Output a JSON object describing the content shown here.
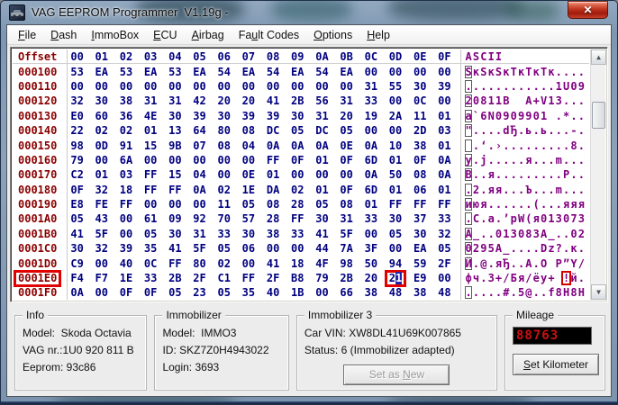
{
  "window": {
    "title": "VAG EEPROM Programmer  V1.19g -",
    "close_glyph": "✕"
  },
  "menu": {
    "items": [
      {
        "label": "File",
        "u": 0
      },
      {
        "label": "Dash",
        "u": 0
      },
      {
        "label": "ImmoBox",
        "u": 0
      },
      {
        "label": "ECU",
        "u": 0
      },
      {
        "label": "Airbag",
        "u": 0
      },
      {
        "label": "Fault Codes",
        "u": 2
      },
      {
        "label": "Options",
        "u": 0
      },
      {
        "label": "Help",
        "u": 0
      }
    ]
  },
  "hex_view": {
    "offset_label": "Offset",
    "columns": [
      "00",
      "01",
      "02",
      "03",
      "04",
      "05",
      "06",
      "07",
      "08",
      "09",
      "0A",
      "0B",
      "0C",
      "0D",
      "0E",
      "0F"
    ],
    "ascii_label": "ASCII",
    "rows": [
      {
        "offset": "000100",
        "bytes": [
          "53",
          "EA",
          "53",
          "EA",
          "53",
          "EA",
          "54",
          "EA",
          "54",
          "EA",
          "54",
          "EA",
          "00",
          "00",
          "00",
          "00"
        ],
        "ascii": "SкSкSкTкTкTк...."
      },
      {
        "offset": "000110",
        "bytes": [
          "00",
          "00",
          "00",
          "00",
          "00",
          "00",
          "00",
          "00",
          "00",
          "00",
          "00",
          "00",
          "31",
          "55",
          "30",
          "39"
        ],
        "ascii": "............1U09"
      },
      {
        "offset": "000120",
        "bytes": [
          "32",
          "30",
          "38",
          "31",
          "31",
          "42",
          "20",
          "20",
          "41",
          "2B",
          "56",
          "31",
          "33",
          "00",
          "0C",
          "00"
        ],
        "ascii": "20811B  A+V13..."
      },
      {
        "offset": "000130",
        "bytes": [
          "E0",
          "60",
          "36",
          "4E",
          "30",
          "39",
          "30",
          "39",
          "39",
          "30",
          "31",
          "20",
          "19",
          "2A",
          "11",
          "01"
        ],
        "ascii": "а`6N0909901 .*.."
      },
      {
        "offset": "000140",
        "bytes": [
          "22",
          "02",
          "02",
          "01",
          "13",
          "64",
          "80",
          "08",
          "DC",
          "05",
          "DC",
          "05",
          "00",
          "00",
          "2D",
          "03"
        ],
        "ascii": "\"....dЂ.ь.ь...-."
      },
      {
        "offset": "000150",
        "bytes": [
          "98",
          "0D",
          "91",
          "15",
          "9B",
          "07",
          "08",
          "04",
          "0A",
          "0A",
          "0A",
          "0E",
          "0A",
          "10",
          "38",
          "01"
        ],
        "ascii": " .‘.›.........8."
      },
      {
        "offset": "000160",
        "bytes": [
          "79",
          "00",
          "6A",
          "00",
          "00",
          "00",
          "00",
          "00",
          "FF",
          "0F",
          "01",
          "0F",
          "6D",
          "01",
          "0F",
          "0A"
        ],
        "ascii": "y.j.....я...m..."
      },
      {
        "offset": "000170",
        "bytes": [
          "C2",
          "01",
          "03",
          "FF",
          "15",
          "04",
          "00",
          "0E",
          "01",
          "00",
          "00",
          "00",
          "0A",
          "50",
          "08",
          "0A"
        ],
        "ascii": "В..я.........P.."
      },
      {
        "offset": "000180",
        "bytes": [
          "0F",
          "32",
          "18",
          "FF",
          "FF",
          "0A",
          "02",
          "1E",
          "DA",
          "02",
          "01",
          "0F",
          "6D",
          "01",
          "06",
          "01"
        ],
        "ascii": ".2.яя...Ъ...m..."
      },
      {
        "offset": "000190",
        "bytes": [
          "E8",
          "FE",
          "FF",
          "00",
          "00",
          "00",
          "11",
          "05",
          "08",
          "28",
          "05",
          "08",
          "01",
          "FF",
          "FF",
          "FF"
        ],
        "ascii": "июя......(...яяя"
      },
      {
        "offset": "0001A0",
        "bytes": [
          "05",
          "43",
          "00",
          "61",
          "09",
          "92",
          "70",
          "57",
          "28",
          "FF",
          "30",
          "31",
          "33",
          "30",
          "37",
          "33"
        ],
        "ascii": ".C.a.’pW(я013073"
      },
      {
        "offset": "0001B0",
        "bytes": [
          "41",
          "5F",
          "00",
          "05",
          "30",
          "31",
          "33",
          "30",
          "38",
          "33",
          "41",
          "5F",
          "00",
          "05",
          "30",
          "32"
        ],
        "ascii": "A_..013083A_..02"
      },
      {
        "offset": "0001C0",
        "bytes": [
          "30",
          "32",
          "39",
          "35",
          "41",
          "5F",
          "05",
          "06",
          "00",
          "00",
          "44",
          "7A",
          "3F",
          "00",
          "EA",
          "05"
        ],
        "ascii": "0295A_....Dz?.к."
      },
      {
        "offset": "0001D0",
        "bytes": [
          "C9",
          "00",
          "40",
          "0C",
          "FF",
          "80",
          "02",
          "00",
          "41",
          "18",
          "4F",
          "98",
          "50",
          "94",
          "59",
          "2F"
        ],
        "ascii": "Й.@.яЂ..A.O P”Y/"
      },
      {
        "offset": "0001E0",
        "bytes": [
          "F4",
          "F7",
          "1E",
          "33",
          "2B",
          "2F",
          "C1",
          "FF",
          "2F",
          "B8",
          "79",
          "2B",
          "20",
          "21",
          "E9",
          "00"
        ],
        "ascii": "фч.3+/Бя/ёy+ !й."
      },
      {
        "offset": "0001F0",
        "bytes": [
          "0A",
          "00",
          "0F",
          "0F",
          "05",
          "23",
          "05",
          "35",
          "40",
          "1B",
          "00",
          "66",
          "38",
          "48",
          "38",
          "48"
        ],
        "ascii": ".....#.5@..f8H8H"
      }
    ],
    "highlight": {
      "offset": "0001E0",
      "byte_col": 13,
      "selected_char_index": 1
    }
  },
  "panels": {
    "info": {
      "legend": "Info",
      "lines": [
        "Model:  Skoda Octavia",
        "VAG nr.:1U0 920 811 B",
        "Eeprom: 93c86"
      ]
    },
    "immobilizer": {
      "legend": "Immobilizer",
      "lines": [
        "Model:  IMMO3",
        "ID: SKZ7Z0H4943022",
        "Login: 3693"
      ]
    },
    "immobilizer3": {
      "legend": "Immobilizer 3",
      "lines": [
        "Car VIN: XW8DL41U69K007865",
        "Status: 6 (Immobilizer adapted)"
      ],
      "button_label": "Set as New",
      "button_u": 7
    },
    "mileage": {
      "legend": "Mileage",
      "value": "88763",
      "button_label": "Set Kilometer",
      "button_u": 0
    }
  },
  "colors": {
    "offset_text": "#8B0000",
    "hex_text": "#000080",
    "ascii_text": "#800080",
    "highlight_box": "#E10000",
    "selection_bg": "#2424AA",
    "mileage_value": "#CC1111",
    "close_button": "#C03520"
  }
}
